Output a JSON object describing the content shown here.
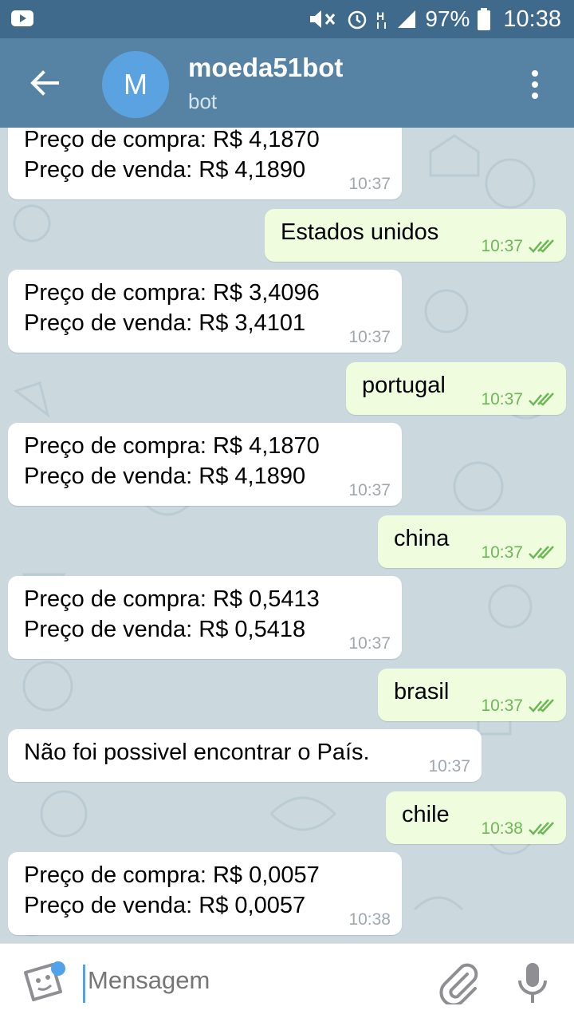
{
  "status_bar": {
    "battery": "97%",
    "time": "10:38",
    "icons": [
      "youtube-icon",
      "mute-icon",
      "alarm-icon",
      "data-h-icon",
      "signal-icon",
      "battery-icon"
    ]
  },
  "header": {
    "avatar_letter": "M",
    "title": "moeda51bot",
    "subtitle": "bot"
  },
  "messages": [
    {
      "dir": "in",
      "lines": [
        "Preço de compra: R$ 4,1870",
        "Preço de venda: R$ 4,1890"
      ],
      "time": "10:37"
    },
    {
      "dir": "out",
      "lines": [
        "Estados unidos"
      ],
      "time": "10:37"
    },
    {
      "dir": "in",
      "lines": [
        "Preço de compra: R$ 3,4096",
        "Preço de venda: R$ 3,4101"
      ],
      "time": "10:37"
    },
    {
      "dir": "out",
      "lines": [
        "portugal"
      ],
      "time": "10:37"
    },
    {
      "dir": "in",
      "lines": [
        "Preço de compra: R$ 4,1870",
        "Preço de venda: R$ 4,1890"
      ],
      "time": "10:37"
    },
    {
      "dir": "out",
      "lines": [
        "china"
      ],
      "time": "10:37"
    },
    {
      "dir": "in",
      "lines": [
        "Preço de compra: R$ 0,5413",
        "Preço de venda: R$ 0,5418"
      ],
      "time": "10:37"
    },
    {
      "dir": "out",
      "lines": [
        "brasil"
      ],
      "time": "10:37"
    },
    {
      "dir": "in",
      "lines": [
        "Não foi possivel encontrar o País."
      ],
      "time": "10:37"
    },
    {
      "dir": "out",
      "lines": [
        "chile"
      ],
      "time": "10:38"
    },
    {
      "dir": "in",
      "lines": [
        "Preço de compra: R$ 0,0057",
        "Preço de venda: R$ 0,0057"
      ],
      "time": "10:38"
    }
  ],
  "input": {
    "placeholder": "Mensagem"
  }
}
